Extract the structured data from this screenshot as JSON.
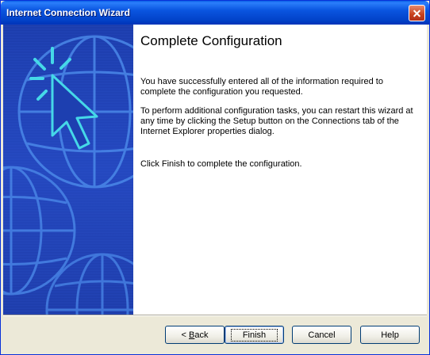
{
  "window": {
    "title": "Internet Connection Wizard"
  },
  "page": {
    "heading": "Complete Configuration",
    "paragraphs": [
      "You have successfully entered all of the information required to complete the configuration you requested.",
      "To perform additional configuration tasks, you can restart this wizard at any time by clicking the Setup button on the Connections tab of the Internet Explorer properties dialog.",
      "Click Finish to complete the configuration."
    ]
  },
  "buttons": {
    "back_prefix": "< ",
    "back_mnemonic": "B",
    "back_rest": "ack",
    "finish": "Finish",
    "cancel": "Cancel",
    "help": "Help"
  },
  "colors": {
    "titlebar": "#0a55e0",
    "side_panel": "#2346bd",
    "dialog_bg": "#ece9d8",
    "globe_lines": "#4a88e8",
    "cursor": "#45d8e8"
  },
  "icons": {
    "close": "close-icon",
    "side_art": "globe-cursor-illustration"
  }
}
